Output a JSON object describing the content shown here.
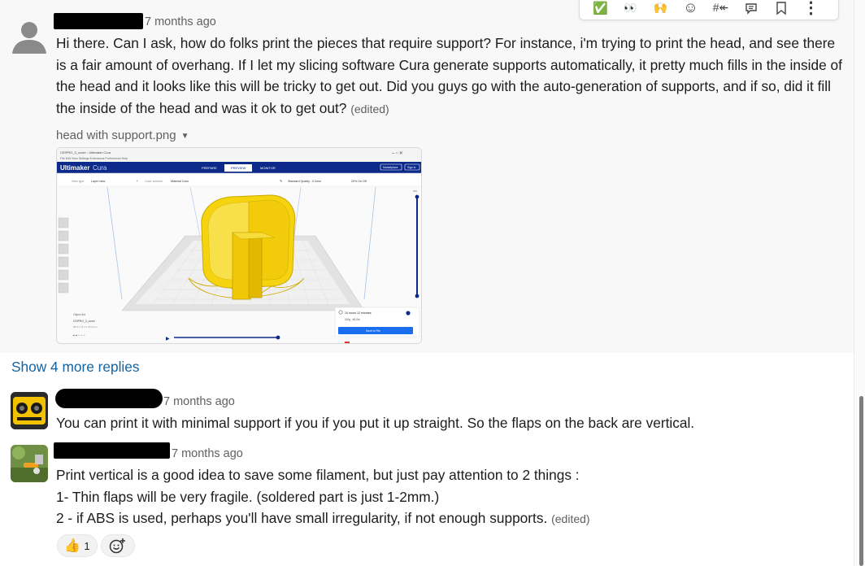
{
  "toolbar": {
    "items": [
      {
        "icon": "check-emoji-icon",
        "glyph": "✅"
      },
      {
        "icon": "eyes-emoji-icon",
        "glyph": "👀"
      },
      {
        "icon": "raised-hands-emoji-icon",
        "glyph": "🙌"
      },
      {
        "icon": "add-reaction-icon",
        "glyph": "☺"
      },
      {
        "icon": "reply-in-thread-icon",
        "glyph": "#↞"
      },
      {
        "icon": "comment-icon",
        "glyph": "💬"
      },
      {
        "icon": "bookmark-icon",
        "glyph": "⌑"
      },
      {
        "icon": "more-actions-icon",
        "glyph": "⋮"
      }
    ]
  },
  "messages": [
    {
      "time": "7 months ago",
      "text": "Hi there. Can I ask, how do folks print the pieces that require support? For instance, i'm trying to print the head, and see there is a fair amount of overhang. If I let my slicing software Cura generate supports automatically, it pretty much fills in the inside of the head and it looks like this will be tricky to get out. Did you guys go with the auto-generation of supports, and if so, did it fill the inside of the head and was it ok to get out?",
      "edited": "(edited)",
      "attachment": {
        "name": "head with support.png",
        "caret": "▼",
        "app": {
          "window_title": "CEIPRO_3_cover - Ultimaker Cura",
          "menu": "File  Edit  View  Settings  Extensions  Preferences  Help",
          "brand": "Ultimaker",
          "brand_sub": "Cura",
          "stages": [
            "PREPARE",
            "PREVIEW",
            "MONITOR"
          ],
          "view_type_label": "View type",
          "view_type_value": "Layer view",
          "color_scheme_label": "Color scheme",
          "color_scheme_value": "Material Color",
          "profile": "Standard Quality - 0.2mm",
          "print_settings": "20%    On    Off",
          "marketplace": "Marketplace",
          "signin": "Sign in",
          "object_list": "Object list",
          "object_name": "CEIPRO_3_cover",
          "object_dims": "85.0 x 74.3 x 79.0 mm",
          "estimate_time": "10 hours 12 minutes",
          "estimate_material": "110g · 46.2m",
          "save_button": "Save to File",
          "layer_top": "300"
        }
      }
    },
    {
      "time": "7 months ago",
      "text": "You can print it with minimal support if you if you put it up straight. So the flaps on the back are vertical."
    },
    {
      "time": "7 months ago",
      "lines": [
        "Print vertical is a good idea to save some filament, but just pay attention to 2 things :",
        "1- Thin flaps will be very fragile. (soldered part is just 1-2mm.)",
        "2 - if ABS is used, perhaps you'll have small irregularity, if not enough supports."
      ],
      "edited": "(edited)",
      "reaction": {
        "emoji": "👍",
        "count": "1"
      }
    }
  ],
  "show_more": "Show 4 more replies",
  "colors": {
    "link": "#1264a3",
    "accent_yellow": "#f5d40f",
    "cura_blue": "#196ef0"
  }
}
